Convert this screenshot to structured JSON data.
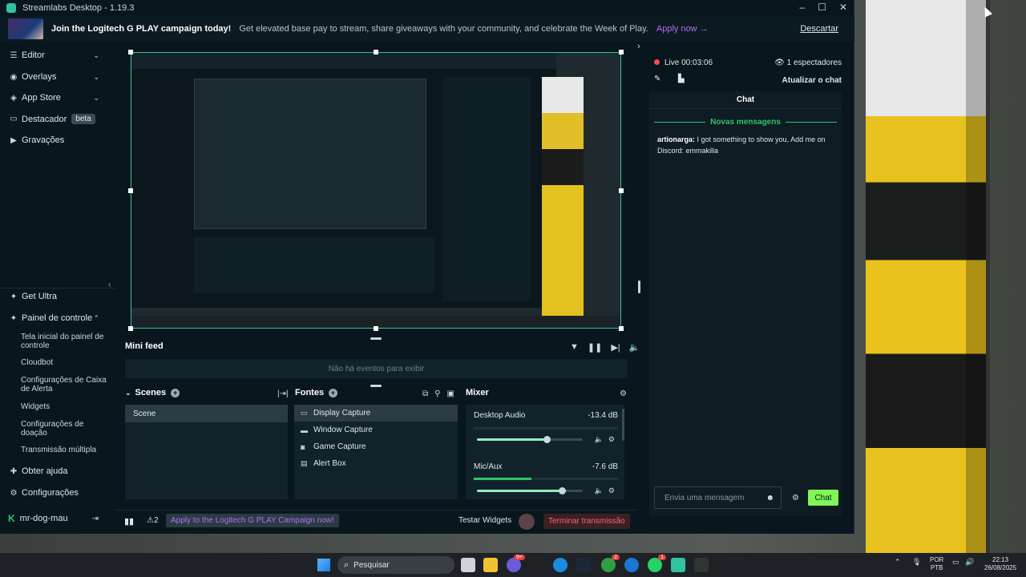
{
  "window": {
    "title": "Streamlabs Desktop - 1.19.3",
    "controls": [
      "–",
      "☐",
      "✕"
    ]
  },
  "banner": {
    "title": "Join the Logitech G PLAY campaign today!",
    "description": "Get elevated base pay to stream, share giveaways with your community, and celebrate the Week of Play.",
    "apply": "Apply now →",
    "dismiss": "Descartar"
  },
  "sidebar": {
    "top_items": [
      {
        "label": "Editor",
        "icon": "editor-icon"
      },
      {
        "label": "Overlays",
        "icon": "overlays-icon"
      },
      {
        "label": "App Store",
        "icon": "appstore-icon"
      },
      {
        "label": "Destacador",
        "badge": "beta",
        "icon": "highlighter-icon"
      },
      {
        "label": "Gravações",
        "icon": "recordings-icon"
      }
    ],
    "bottom_items": {
      "get_ultra": "Get Ultra",
      "dashboard": "Painel de controle",
      "sub": [
        "Tela inicial do painel de controle",
        "Cloudbot",
        "Configurações de Caixa de Alerta",
        "Widgets",
        "Configurações de doação",
        "Transmissão múltipla"
      ],
      "help": "Obter ajuda",
      "settings": "Configurações"
    },
    "user": "mr-dog-mau"
  },
  "minifeed": {
    "title": "Mini feed",
    "empty": "Não há eventos para exibir"
  },
  "scenes": {
    "title": "Scenes",
    "items": [
      "Scene"
    ]
  },
  "sources": {
    "title": "Fontes",
    "items": [
      {
        "label": "Display Capture",
        "icon": "monitor-icon"
      },
      {
        "label": "Window Capture",
        "icon": "window-icon"
      },
      {
        "label": "Game Capture",
        "icon": "gamepad-icon"
      },
      {
        "label": "Alert Box",
        "icon": "alert-icon"
      }
    ]
  },
  "mixer": {
    "title": "Mixer",
    "channels": [
      {
        "name": "Desktop Audio",
        "db": "-13.4 dB",
        "level": 0.0,
        "volume": 0.66
      },
      {
        "name": "Mic/Aux",
        "db": "-7.6 dB",
        "level": 0.4,
        "volume": 0.8
      }
    ]
  },
  "footer": {
    "alerts_count": "2",
    "promo": "Apply to the Logitech G PLAY Campaign now!",
    "test_widgets": "Testar Widgets",
    "end_stream": "Terminar transmissão"
  },
  "stream": {
    "live": "Live 00:03:06",
    "viewers": "1 espectadores",
    "refresh_chat": "Atualizar o chat"
  },
  "chat": {
    "title": "Chat",
    "new_messages": "Novas mensagens",
    "messages": [
      {
        "user": "artionarga:",
        "text": "I got something to show you, Add me on Discord: emmakilla"
      }
    ],
    "input_placeholder": "Envia uma mensagem",
    "send": "Chat"
  },
  "taskbar": {
    "search": "Pesquisar",
    "lang_top": "POR",
    "lang_bottom": "PTB",
    "time": "22:13",
    "date": "26/08/2025",
    "badges": [
      "9+",
      "2",
      "1"
    ]
  }
}
